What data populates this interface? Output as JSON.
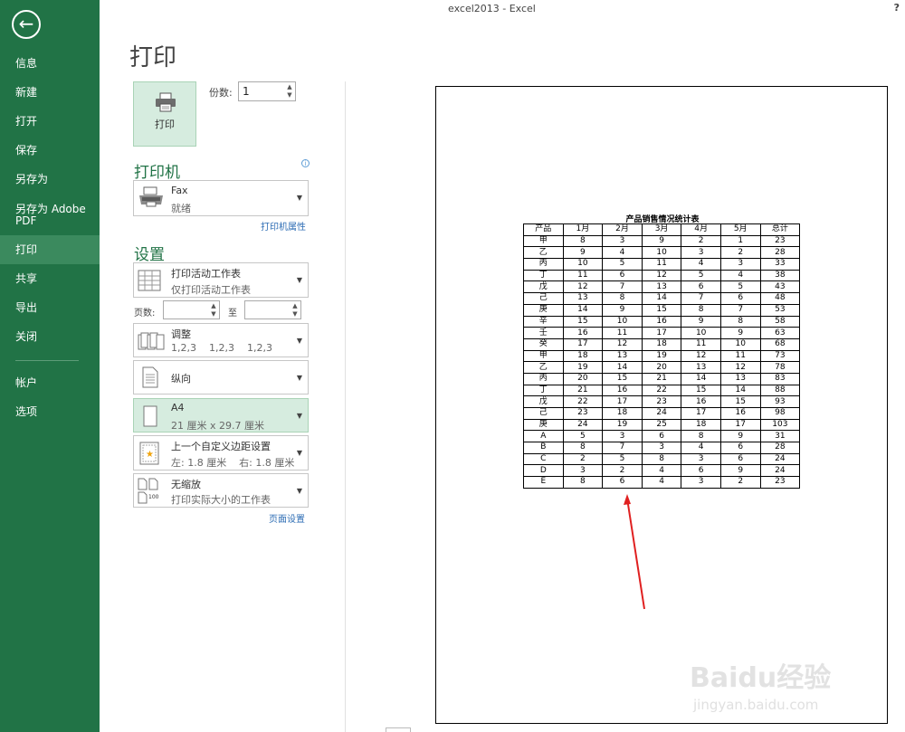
{
  "window": {
    "title": "excel2013 - Excel",
    "help": "?"
  },
  "sidebar": {
    "back": "←",
    "items": [
      {
        "label": "信息"
      },
      {
        "label": "新建"
      },
      {
        "label": "打开"
      },
      {
        "label": "保存"
      },
      {
        "label": "另存为"
      },
      {
        "label": "另存为 Adobe PDF"
      },
      {
        "label": "打印",
        "active": true
      },
      {
        "label": "共享"
      },
      {
        "label": "导出"
      },
      {
        "label": "关闭"
      },
      {
        "label": "帐户"
      },
      {
        "label": "选项"
      }
    ]
  },
  "main": {
    "title": "打印",
    "print_button": "打印",
    "copies": {
      "label": "份数:",
      "value": "1"
    },
    "printer": {
      "heading": "打印机",
      "name": "Fax",
      "status": "就绪",
      "properties_link": "打印机属性"
    },
    "settings": {
      "heading": "设置",
      "what": {
        "title": "打印活动工作表",
        "sub": "仅打印活动工作表"
      },
      "pages": {
        "label": "页数:",
        "to": "至"
      },
      "collate": {
        "title": "调整",
        "sub": "1,2,3    1,2,3    1,2,3"
      },
      "orientation": {
        "title": "纵向"
      },
      "paper": {
        "title": "A4",
        "sub": "21 厘米 x 29.7 厘米"
      },
      "margins": {
        "title": "上一个自定义边距设置",
        "sub": "左: 1.8 厘米    右: 1.8 厘米"
      },
      "scaling": {
        "title": "无缩放",
        "sub": "打印实际大小的工作表",
        "icon_text": "100"
      },
      "page_setup_link": "页面设置"
    }
  },
  "preview": {
    "sheet_title": "产品销售情况统计表",
    "table": {
      "headers": [
        "产品",
        "1月",
        "2月",
        "3月",
        "4月",
        "5月",
        "总计"
      ],
      "rows": [
        [
          "甲",
          "8",
          "3",
          "9",
          "2",
          "1",
          "23"
        ],
        [
          "乙",
          "9",
          "4",
          "10",
          "3",
          "2",
          "28"
        ],
        [
          "丙",
          "10",
          "5",
          "11",
          "4",
          "3",
          "33"
        ],
        [
          "丁",
          "11",
          "6",
          "12",
          "5",
          "4",
          "38"
        ],
        [
          "戊",
          "12",
          "7",
          "13",
          "6",
          "5",
          "43"
        ],
        [
          "己",
          "13",
          "8",
          "14",
          "7",
          "6",
          "48"
        ],
        [
          "庚",
          "14",
          "9",
          "15",
          "8",
          "7",
          "53"
        ],
        [
          "辛",
          "15",
          "10",
          "16",
          "9",
          "8",
          "58"
        ],
        [
          "壬",
          "16",
          "11",
          "17",
          "10",
          "9",
          "63"
        ],
        [
          "癸",
          "17",
          "12",
          "18",
          "11",
          "10",
          "68"
        ],
        [
          "甲",
          "18",
          "13",
          "19",
          "12",
          "11",
          "73"
        ],
        [
          "乙",
          "19",
          "14",
          "20",
          "13",
          "12",
          "78"
        ],
        [
          "丙",
          "20",
          "15",
          "21",
          "14",
          "13",
          "83"
        ],
        [
          "丁",
          "21",
          "16",
          "22",
          "15",
          "14",
          "88"
        ],
        [
          "戊",
          "22",
          "17",
          "23",
          "16",
          "15",
          "93"
        ],
        [
          "己",
          "23",
          "18",
          "24",
          "17",
          "16",
          "98"
        ],
        [
          "庚",
          "24",
          "19",
          "25",
          "18",
          "17",
          "103"
        ],
        [
          "A",
          "5",
          "3",
          "6",
          "8",
          "9",
          "31"
        ],
        [
          "B",
          "8",
          "7",
          "3",
          "4",
          "6",
          "28"
        ],
        [
          "C",
          "2",
          "5",
          "8",
          "3",
          "6",
          "24"
        ],
        [
          "D",
          "3",
          "2",
          "4",
          "6",
          "9",
          "24"
        ],
        [
          "E",
          "8",
          "6",
          "4",
          "3",
          "2",
          "23"
        ]
      ]
    }
  },
  "watermark": {
    "main": "Baidu经验",
    "sub": "jingyan.baidu.com"
  },
  "colors": {
    "sidebar": "#217346",
    "active": "#3b8a5e",
    "accent": "#217346",
    "link": "#2f6eb5",
    "selected": "#d6ecdf",
    "annotation": "#e02020"
  }
}
